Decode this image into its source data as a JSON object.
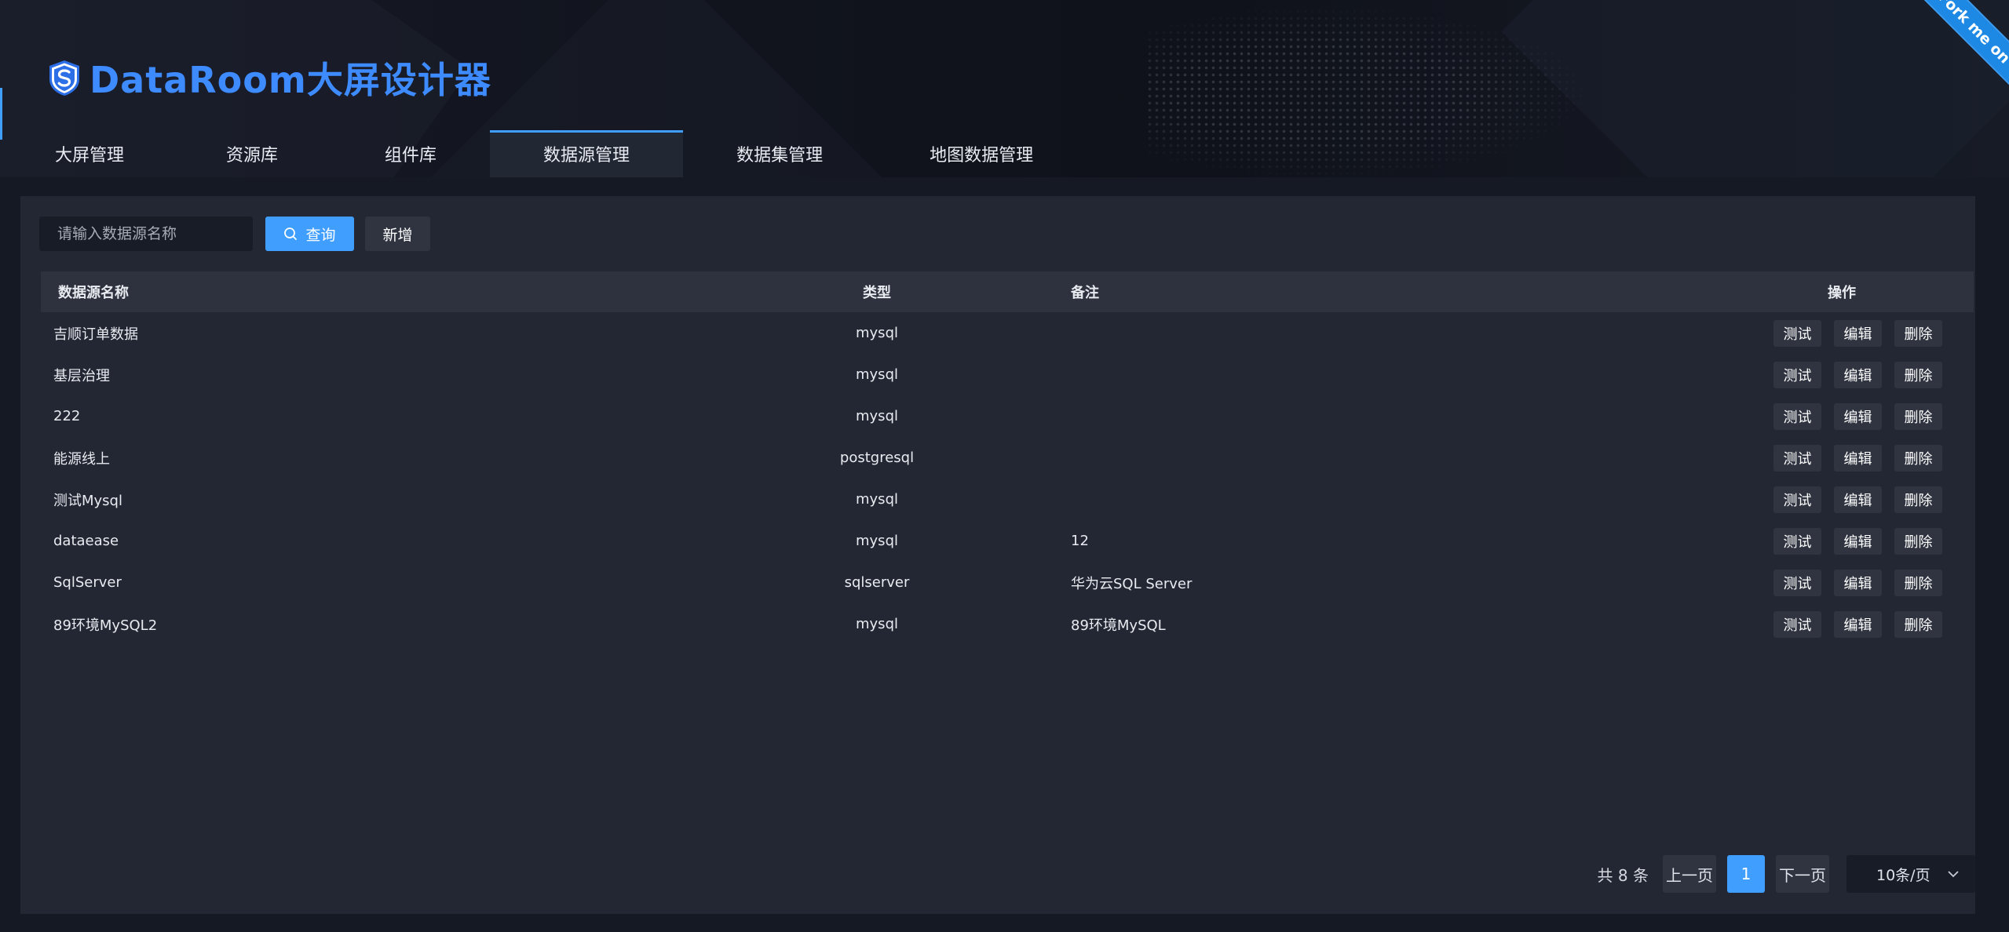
{
  "app": {
    "title": "DataRoom大屏设计器",
    "ribbon": "Fork me on GitHub",
    "brand_color": "#409eff"
  },
  "nav": {
    "items": [
      {
        "label": "大屏管理",
        "active": false
      },
      {
        "label": "资源库",
        "active": false
      },
      {
        "label": "组件库",
        "active": false
      },
      {
        "label": "数据源管理",
        "active": true
      },
      {
        "label": "数据集管理",
        "active": false
      },
      {
        "label": "地图数据管理",
        "active": false
      }
    ]
  },
  "toolbar": {
    "search_placeholder": "请输入数据源名称",
    "query_label": "查询",
    "add_label": "新增"
  },
  "table": {
    "headers": {
      "name": "数据源名称",
      "type": "类型",
      "note": "备注",
      "ops": "操作"
    },
    "rows": [
      {
        "name": "吉顺订单数据",
        "type": "mysql",
        "note": ""
      },
      {
        "name": "基层治理",
        "type": "mysql",
        "note": ""
      },
      {
        "name": "222",
        "type": "mysql",
        "note": ""
      },
      {
        "name": "能源线上",
        "type": "postgresql",
        "note": ""
      },
      {
        "name": "测试Mysql",
        "type": "mysql",
        "note": ""
      },
      {
        "name": "dataease",
        "type": "mysql",
        "note": "12"
      },
      {
        "name": "SqlServer",
        "type": "sqlserver",
        "note": "华为云SQL Server"
      },
      {
        "name": "89环境MySQL2",
        "type": "mysql",
        "note": "89环境MySQL"
      }
    ],
    "actions": {
      "test": "测试",
      "edit": "编辑",
      "delete": "删除"
    }
  },
  "pagination": {
    "total_text": "共 8 条",
    "prev_label": "上一页",
    "next_label": "下一页",
    "current_page": "1",
    "page_size": "10条/页"
  }
}
